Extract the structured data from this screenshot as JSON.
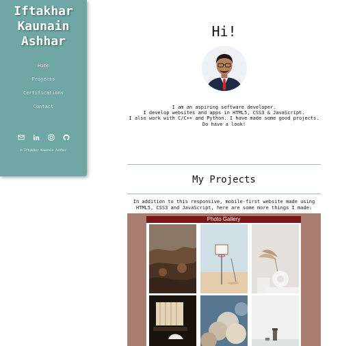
{
  "sidebar": {
    "name_lines": [
      "Iftakhar",
      "Kaunain",
      "Ashhar"
    ],
    "nav": [
      "Home",
      "Projects",
      "Certifications",
      "Contact"
    ],
    "socials": [
      "mail-icon",
      "linkedin-icon",
      "instagram-icon",
      "github-icon"
    ],
    "copyright": "© Iftakhar Kaunain Ashhar"
  },
  "hero": {
    "greeting": "Hi!",
    "bio": [
      "I am an aspiring software developer.",
      "I develop websites and apps in HTML5, CSS3 & JavaScript.",
      "I also work with C/C++ and Python. I have made some good projects.",
      "Do have a look!"
    ]
  },
  "projects": {
    "title": "My Projects",
    "description": "In addition to this responsive, mobile-first website made using HTML5, CSS3 and JavaScript, here are some more things I made:"
  },
  "gallery": {
    "title": "Photo Gallery",
    "photos": [
      "foggy-forest",
      "basketball-hoop",
      "dried-flower-vase",
      "curtain-window",
      "cloudy-sky",
      "lighthouse-sea"
    ]
  },
  "colors": {
    "sidebar": "#6fa7a6",
    "gallery_frame": "#a97d6f",
    "gallery_header": "#7b1616"
  }
}
